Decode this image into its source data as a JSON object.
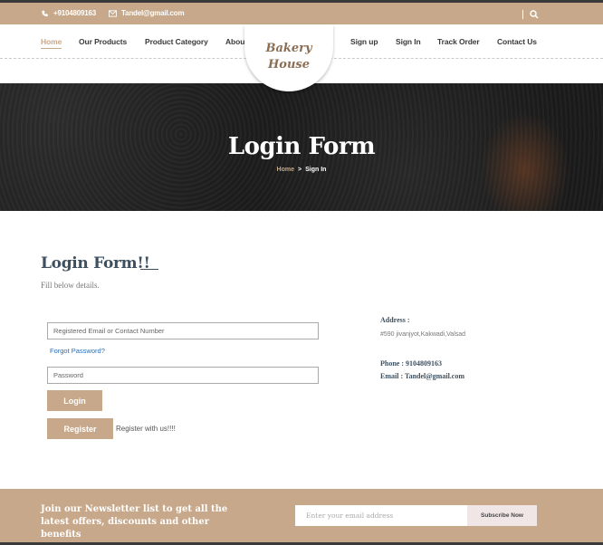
{
  "topbar": {
    "phone": "+9104809163",
    "email": "Tandel@gmail.com",
    "icons": {
      "phone": "phone-icon",
      "email": "envelope-icon",
      "search": "search-icon"
    }
  },
  "nav": {
    "left": [
      {
        "label": "Home",
        "active": true
      },
      {
        "label": "Our Products"
      },
      {
        "label": "Product Category"
      },
      {
        "label": "About Us"
      }
    ],
    "right": [
      {
        "label": "Sign up"
      },
      {
        "label": "Sign In"
      },
      {
        "label": "Track Order"
      },
      {
        "label": "Contact Us"
      }
    ],
    "logo": {
      "line1": "Bakery",
      "line2": "House"
    }
  },
  "hero": {
    "title": "Login Form",
    "breadcrumb": {
      "home": "Home",
      "separator": ">",
      "current": "Sign In"
    }
  },
  "form": {
    "heading": "Login Form!!",
    "subtitle": "Fill below details.",
    "email_placeholder": "Registered Email or Contact Number",
    "forgot_label": "Forgot Password?",
    "password_placeholder": "Password",
    "login_label": "Login",
    "register_label": "Register",
    "register_note": "Register with us!!!!"
  },
  "contact": {
    "address_label": "Address :",
    "address": "#590 jivanjyot,Kakwadi,Valsad",
    "phone": "Phone : 9104809163",
    "email": "Email : Tandel@gmail.com"
  },
  "newsletter": {
    "text": "Join our Newsletter list to get all the latest offers, discounts and other benefits",
    "email_placeholder": "Enter your email address",
    "subscribe_label": "Subscribe Now"
  },
  "colors": {
    "accent": "#c7a88a",
    "heading": "#3e5060",
    "link": "#2a6fb5"
  }
}
